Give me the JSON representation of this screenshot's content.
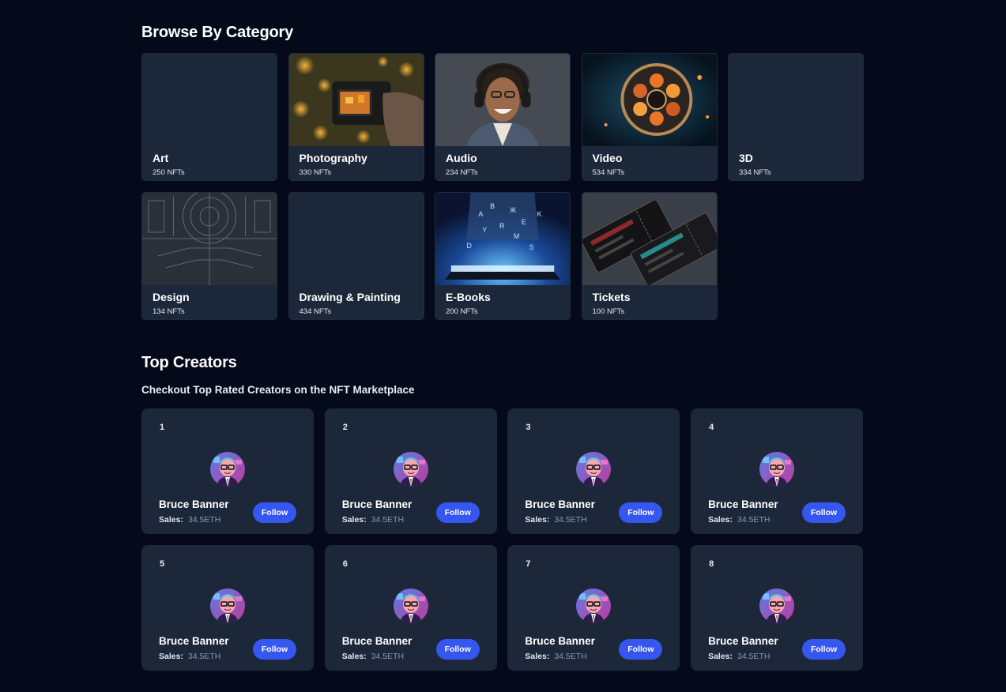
{
  "categories_section": {
    "title": "Browse By Category",
    "items": [
      {
        "name": "Art",
        "count": "250 NFTs",
        "image": "none"
      },
      {
        "name": "Photography",
        "count": "330 NFTs",
        "image": "camera-photo"
      },
      {
        "name": "Audio",
        "count": "234 NFTs",
        "image": "headphones-photo"
      },
      {
        "name": "Video",
        "count": "534 NFTs",
        "image": "film-reel-photo"
      },
      {
        "name": "3D",
        "count": "334 NFTs",
        "image": "none"
      },
      {
        "name": "Design",
        "count": "134 NFTs",
        "image": "blueprint-photo"
      },
      {
        "name": "Drawing & Painting",
        "count": "434 NFTs",
        "image": "none"
      },
      {
        "name": "E-Books",
        "count": "200 NFTs",
        "image": "ebook-photo"
      },
      {
        "name": "Tickets",
        "count": "100 NFTs",
        "image": "tickets-photo"
      }
    ]
  },
  "creators_section": {
    "title": "Top Creators",
    "subtitle": "Checkout Top Rated Creators on the NFT Marketplace",
    "sales_label": "Sales:",
    "follow_label": "Follow",
    "items": [
      {
        "rank": "1",
        "name": "Bruce Banner",
        "sales": "34.5ETH"
      },
      {
        "rank": "2",
        "name": "Bruce Banner",
        "sales": "34.5ETH"
      },
      {
        "rank": "3",
        "name": "Bruce Banner",
        "sales": "34.5ETH"
      },
      {
        "rank": "4",
        "name": "Bruce Banner",
        "sales": "34.5ETH"
      },
      {
        "rank": "5",
        "name": "Bruce Banner",
        "sales": "34.5ETH"
      },
      {
        "rank": "6",
        "name": "Bruce Banner",
        "sales": "34.5ETH"
      },
      {
        "rank": "7",
        "name": "Bruce Banner",
        "sales": "34.5ETH"
      },
      {
        "rank": "8",
        "name": "Bruce Banner",
        "sales": "34.5ETH"
      }
    ]
  },
  "colors": {
    "background": "#050a1a",
    "card": "#1c273a",
    "accent": "#3656f0"
  }
}
